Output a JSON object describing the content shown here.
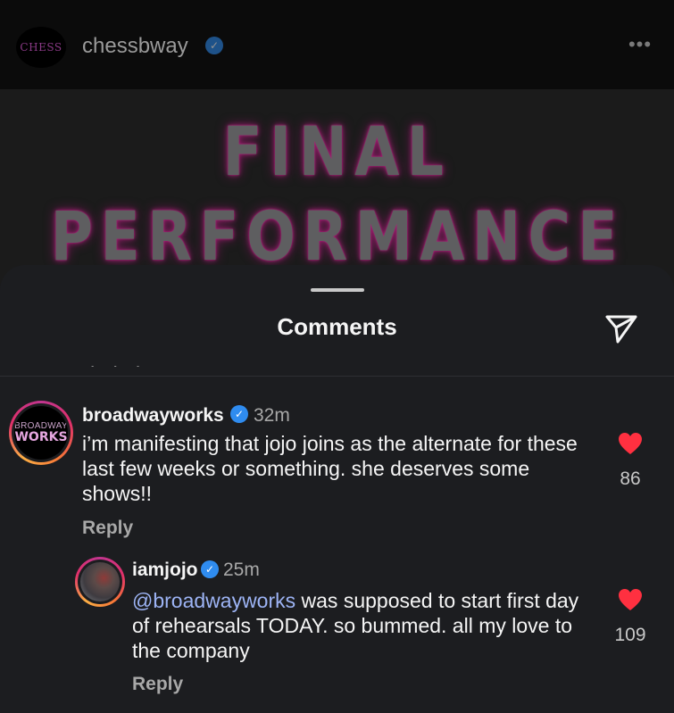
{
  "post": {
    "username": "chessbway",
    "avatar_text": "CHESS",
    "more_icon": "more-horizontal-icon",
    "image_line1": "FINAL",
    "image_line2": "PERFORMANCE"
  },
  "sheet": {
    "title": "Comments",
    "share_icon": "paper-plane-icon"
  },
  "comments": [
    {
      "username": "broadwayworks",
      "avatar_top": "BROADWAY",
      "avatar_bottom": "WORKS",
      "time": "32m",
      "text": "i’m manifesting that jojo joins as the alternate for these last few weeks or something. she deserves some shows!!",
      "reply_label": "Reply",
      "likes": "86"
    },
    {
      "username": "iamjojo",
      "time": "25m",
      "mention": "@broadwayworks",
      "text": " was supposed to start first day of rehearsals TODAY. so bummed. all my love to the company",
      "reply_label": "Reply",
      "likes": "109"
    }
  ],
  "colors": {
    "sheet_bg": "#1c1d20",
    "heart": "#ff3040",
    "verified": "#2f8cf0",
    "mention": "#9db4f5"
  }
}
